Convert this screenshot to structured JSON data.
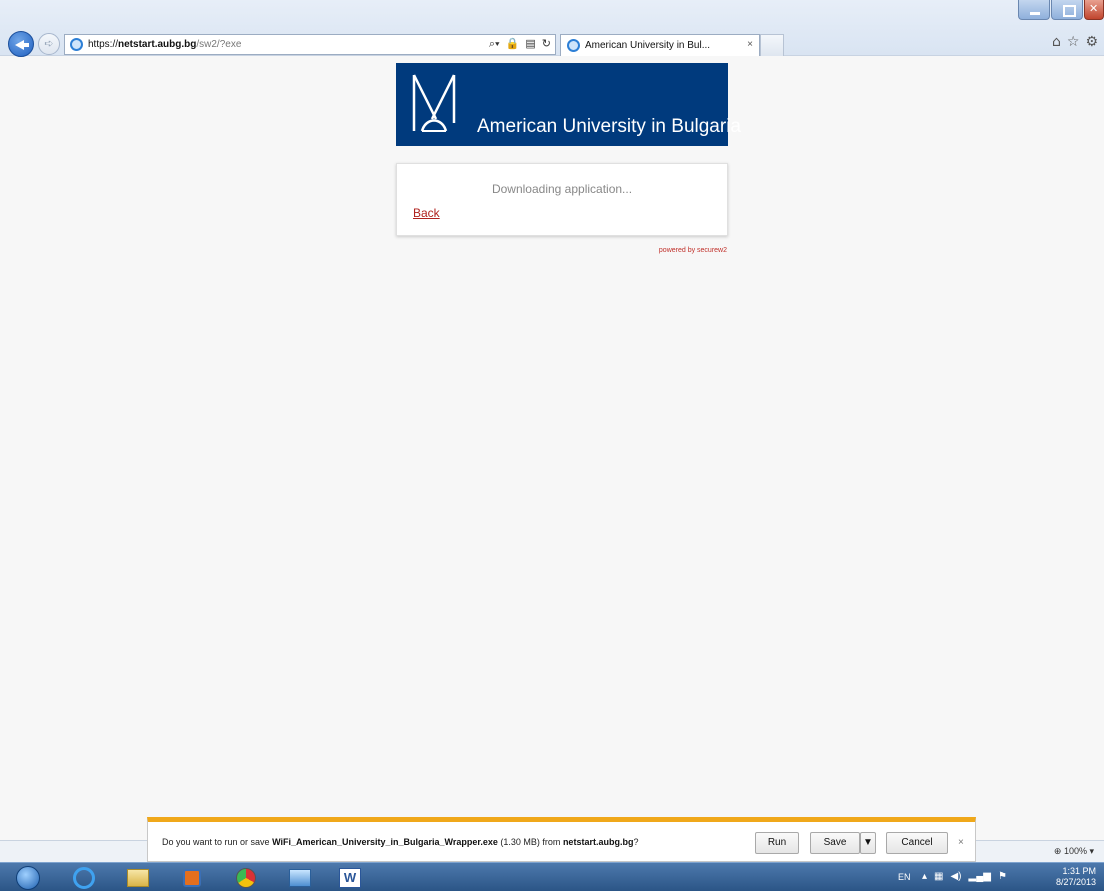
{
  "browser": {
    "url_prefix": "https://",
    "url_host": "netstart.aubg.bg",
    "url_path": "/sw2/?exe",
    "tab_title": "American University in Bul...",
    "tab_close": "×",
    "icons": [
      "back-arrow-icon",
      "forward-arrow-icon",
      "ie-logo-icon",
      "search-icon",
      "lock-icon",
      "compat-icon",
      "refresh-icon",
      "home-icon",
      "favorites-star-icon",
      "gear-icon"
    ]
  },
  "page": {
    "banner_text": "American University in Bulgaria",
    "status_text": "Downloading application...",
    "back_link": "Back",
    "powered_by": "powered by securew2",
    "brand_color": "#003a7d",
    "link_color": "#b0221e"
  },
  "notification": {
    "prefix": "Do you want to run or save ",
    "filename": "WiFi_American_University_in_Bulgaria_Wrapper.exe",
    "size": " (1.30 MB) from ",
    "host": "netstart.aubg.bg",
    "suffix": "?",
    "run_label": "Run",
    "save_label": "Save",
    "cancel_label": "Cancel",
    "close_label": "×",
    "accent_color": "#f0a81a"
  },
  "statusbar": {
    "zoom": "100%"
  },
  "taskbar": {
    "apps": [
      "windows-start-icon",
      "internet-explorer-icon",
      "file-explorer-icon",
      "media-player-icon",
      "chrome-icon",
      "remote-desktop-icon",
      "word-icon"
    ],
    "language": "EN",
    "time": "1:31 PM",
    "date": "8/27/2013"
  }
}
